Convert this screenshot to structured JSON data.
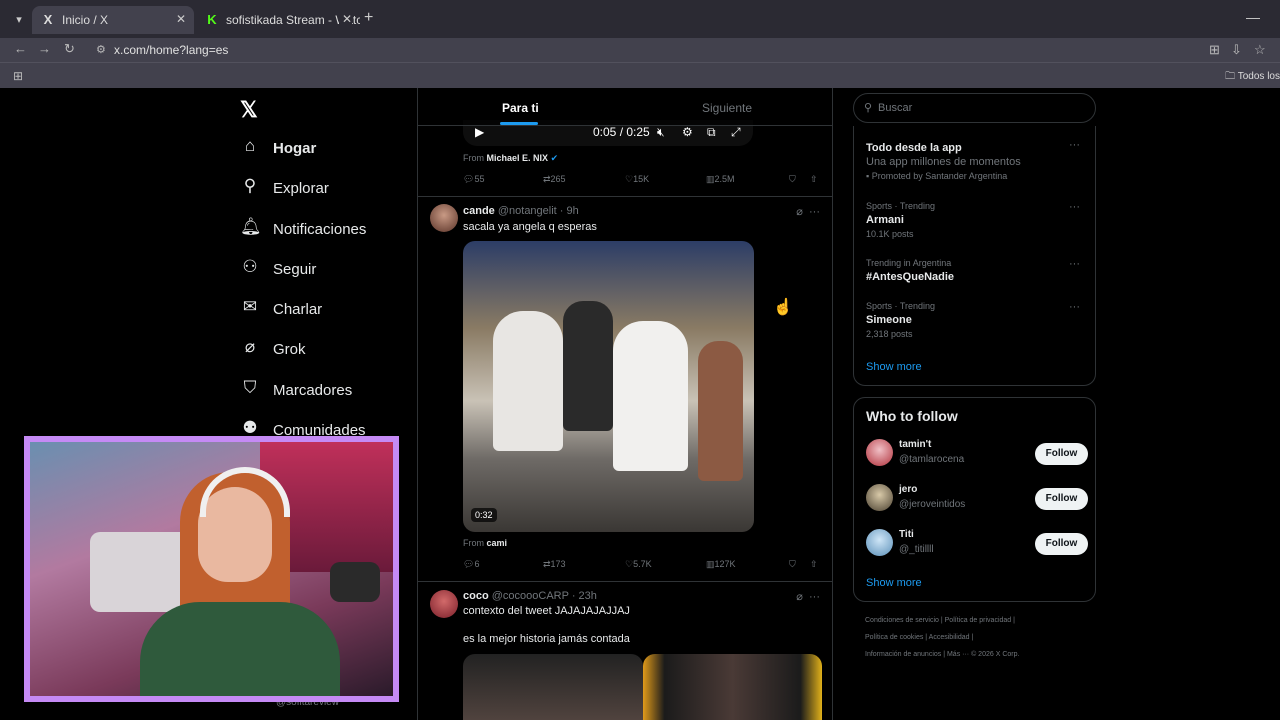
{
  "browser": {
    "tabs": [
      {
        "title": "Inicio / X",
        "favicon": "X",
        "active": true
      },
      {
        "title": "sofistikada Stream - Watch Live",
        "favicon": "K",
        "active": false
      }
    ],
    "url": "x.com/home?lang=es",
    "bookmark_folder": "Todos los"
  },
  "nav": {
    "items": [
      {
        "label": "Hogar",
        "icon": "home-icon"
      },
      {
        "label": "Explorar",
        "icon": "search-icon"
      },
      {
        "label": "Notificaciones",
        "icon": "bell-icon"
      },
      {
        "label": "Seguir",
        "icon": "add-user-icon"
      },
      {
        "label": "Charlar",
        "icon": "mail-icon"
      },
      {
        "label": "Grok",
        "icon": "grok-icon"
      },
      {
        "label": "Marcadores",
        "icon": "bookmark-icon"
      },
      {
        "label": "Comunidades",
        "icon": "communities-icon"
      }
    ],
    "under_cam": "@sofitareview"
  },
  "feed": {
    "tabs": [
      "Para ti",
      "Siguiente"
    ],
    "video_time": "0:05 / 0:25",
    "post0": {
      "from_label": "From",
      "from_name": "Michael E. NIX",
      "replies": "55",
      "reposts": "265",
      "likes": "15K",
      "views": "2.5M"
    },
    "post1": {
      "name": "cande",
      "handle": "@notangelit",
      "time": "· 9h",
      "text": "sacala ya angela q esperas",
      "duration": "0:32",
      "from_label": "From",
      "from_name": "cami",
      "replies": "6",
      "reposts": "173",
      "likes": "5.7K",
      "views": "127K"
    },
    "post2": {
      "name": "coco",
      "handle": "@cocoooCARP",
      "time": "· 23h",
      "text1": "contexto del tweet JAJAJAJAJJAJ",
      "text2": "es la mejor historia jamás contada"
    }
  },
  "right": {
    "search_placeholder": "Buscar",
    "trends": [
      {
        "meta": "",
        "name": "Todo desde la app",
        "sub": "Una app millones de momentos",
        "posts": "Promoted by Santander Argentina"
      },
      {
        "meta": "Sports · Trending",
        "name": "Armani",
        "sub": "",
        "posts": "10.1K posts"
      },
      {
        "meta": "Trending in Argentina",
        "name": "#AntesQueNadie",
        "sub": "",
        "posts": ""
      },
      {
        "meta": "Sports · Trending",
        "name": "Simeone",
        "sub": "",
        "posts": "2,318 posts"
      }
    ],
    "show_more": "Show more",
    "who_to_follow": {
      "title": "Who to follow",
      "users": [
        {
          "name": "tamin't",
          "handle": "@tamlarocena"
        },
        {
          "name": "jero",
          "handle": "@jeroveintidos"
        },
        {
          "name": "Titi",
          "handle": "@_titillll"
        }
      ],
      "follow_label": "Follow",
      "show_more": "Show more"
    },
    "footer": {
      "line1": "Condiciones de servicio  |  Política de privacidad  |",
      "line2": "Política de cookies  |  Accesibilidad  |",
      "line3": "Información de anuncios  |  Más ···  © 2026 X Corp."
    }
  },
  "colors": {
    "accent": "#1d9bf0",
    "webcam_border": "#c58af5"
  }
}
